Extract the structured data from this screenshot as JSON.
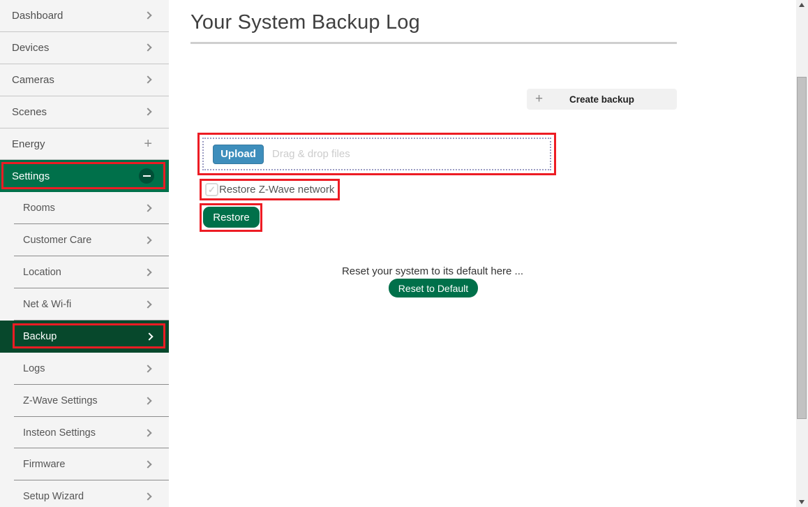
{
  "sidebar": {
    "items": [
      {
        "label": "Dashboard",
        "level": 1,
        "icon": "chevron-right"
      },
      {
        "label": "Devices",
        "level": 1,
        "icon": "chevron-right"
      },
      {
        "label": "Cameras",
        "level": 1,
        "icon": "chevron-right"
      },
      {
        "label": "Scenes",
        "level": 1,
        "icon": "chevron-right"
      },
      {
        "label": "Energy",
        "level": 1,
        "icon": "plus"
      },
      {
        "label": "Settings",
        "level": 1,
        "icon": "minus-circle",
        "active": true,
        "annotated": true
      },
      {
        "label": "Rooms",
        "level": 2,
        "icon": "chevron-right"
      },
      {
        "label": "Customer Care",
        "level": 2,
        "icon": "chevron-right"
      },
      {
        "label": "Location",
        "level": 2,
        "icon": "chevron-right"
      },
      {
        "label": "Net & Wi-fi",
        "level": 2,
        "icon": "chevron-right"
      },
      {
        "label": "Backup",
        "level": 2,
        "icon": "chevron-right",
        "active": true,
        "annotated": true
      },
      {
        "label": "Logs",
        "level": 2,
        "icon": "chevron-right"
      },
      {
        "label": "Z-Wave Settings",
        "level": 2,
        "icon": "chevron-right"
      },
      {
        "label": "Insteon Settings",
        "level": 2,
        "icon": "chevron-right"
      },
      {
        "label": "Firmware",
        "level": 2,
        "icon": "chevron-right"
      },
      {
        "label": "Setup Wizard",
        "level": 2,
        "icon": "chevron-right"
      }
    ]
  },
  "main": {
    "title": "Your System Backup Log",
    "create_backup": {
      "icon": "plus-icon",
      "label": "Create backup",
      "plus_glyph": "+"
    },
    "upload": {
      "button_label": "Upload",
      "placeholder": "Drag & drop files"
    },
    "restore_checkbox": {
      "label": "Restore Z-Wave network",
      "checked": true,
      "check_glyph": "✓"
    },
    "restore_button_label": "Restore",
    "reset_text": "Reset your system to its default here ...",
    "reset_button_label": "Reset to Default"
  },
  "energy_plus_glyph": "+",
  "colors": {
    "accent_green": "#00704A",
    "dark_green": "#07482C",
    "circle_green": "#004F37",
    "upload_blue": "#3E8EBC",
    "upload_blue_border": "#35789F",
    "annotation_red": "#ED1C24",
    "sidebar_bg": "#F4F4F4",
    "divider_gray": "#CFCFCF"
  }
}
